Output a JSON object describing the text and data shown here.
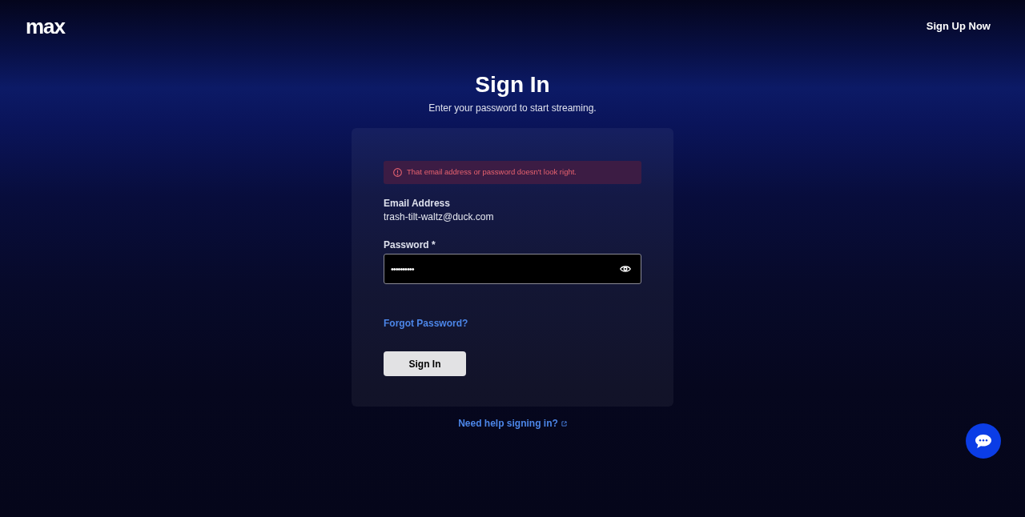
{
  "header": {
    "logo": "max",
    "sign_up_link": "Sign Up Now"
  },
  "title": "Sign In",
  "subtitle": "Enter your password to start streaming.",
  "form": {
    "error": "That email address or password doesn't look right.",
    "email_label": "Email Address",
    "email_value": "trash-tilt-waltz@duck.com",
    "password_label": "Password *",
    "password_value": "••••••••••",
    "forgot_link": "Forgot Password?",
    "submit_button": "Sign In"
  },
  "help_link": "Need help signing in?"
}
